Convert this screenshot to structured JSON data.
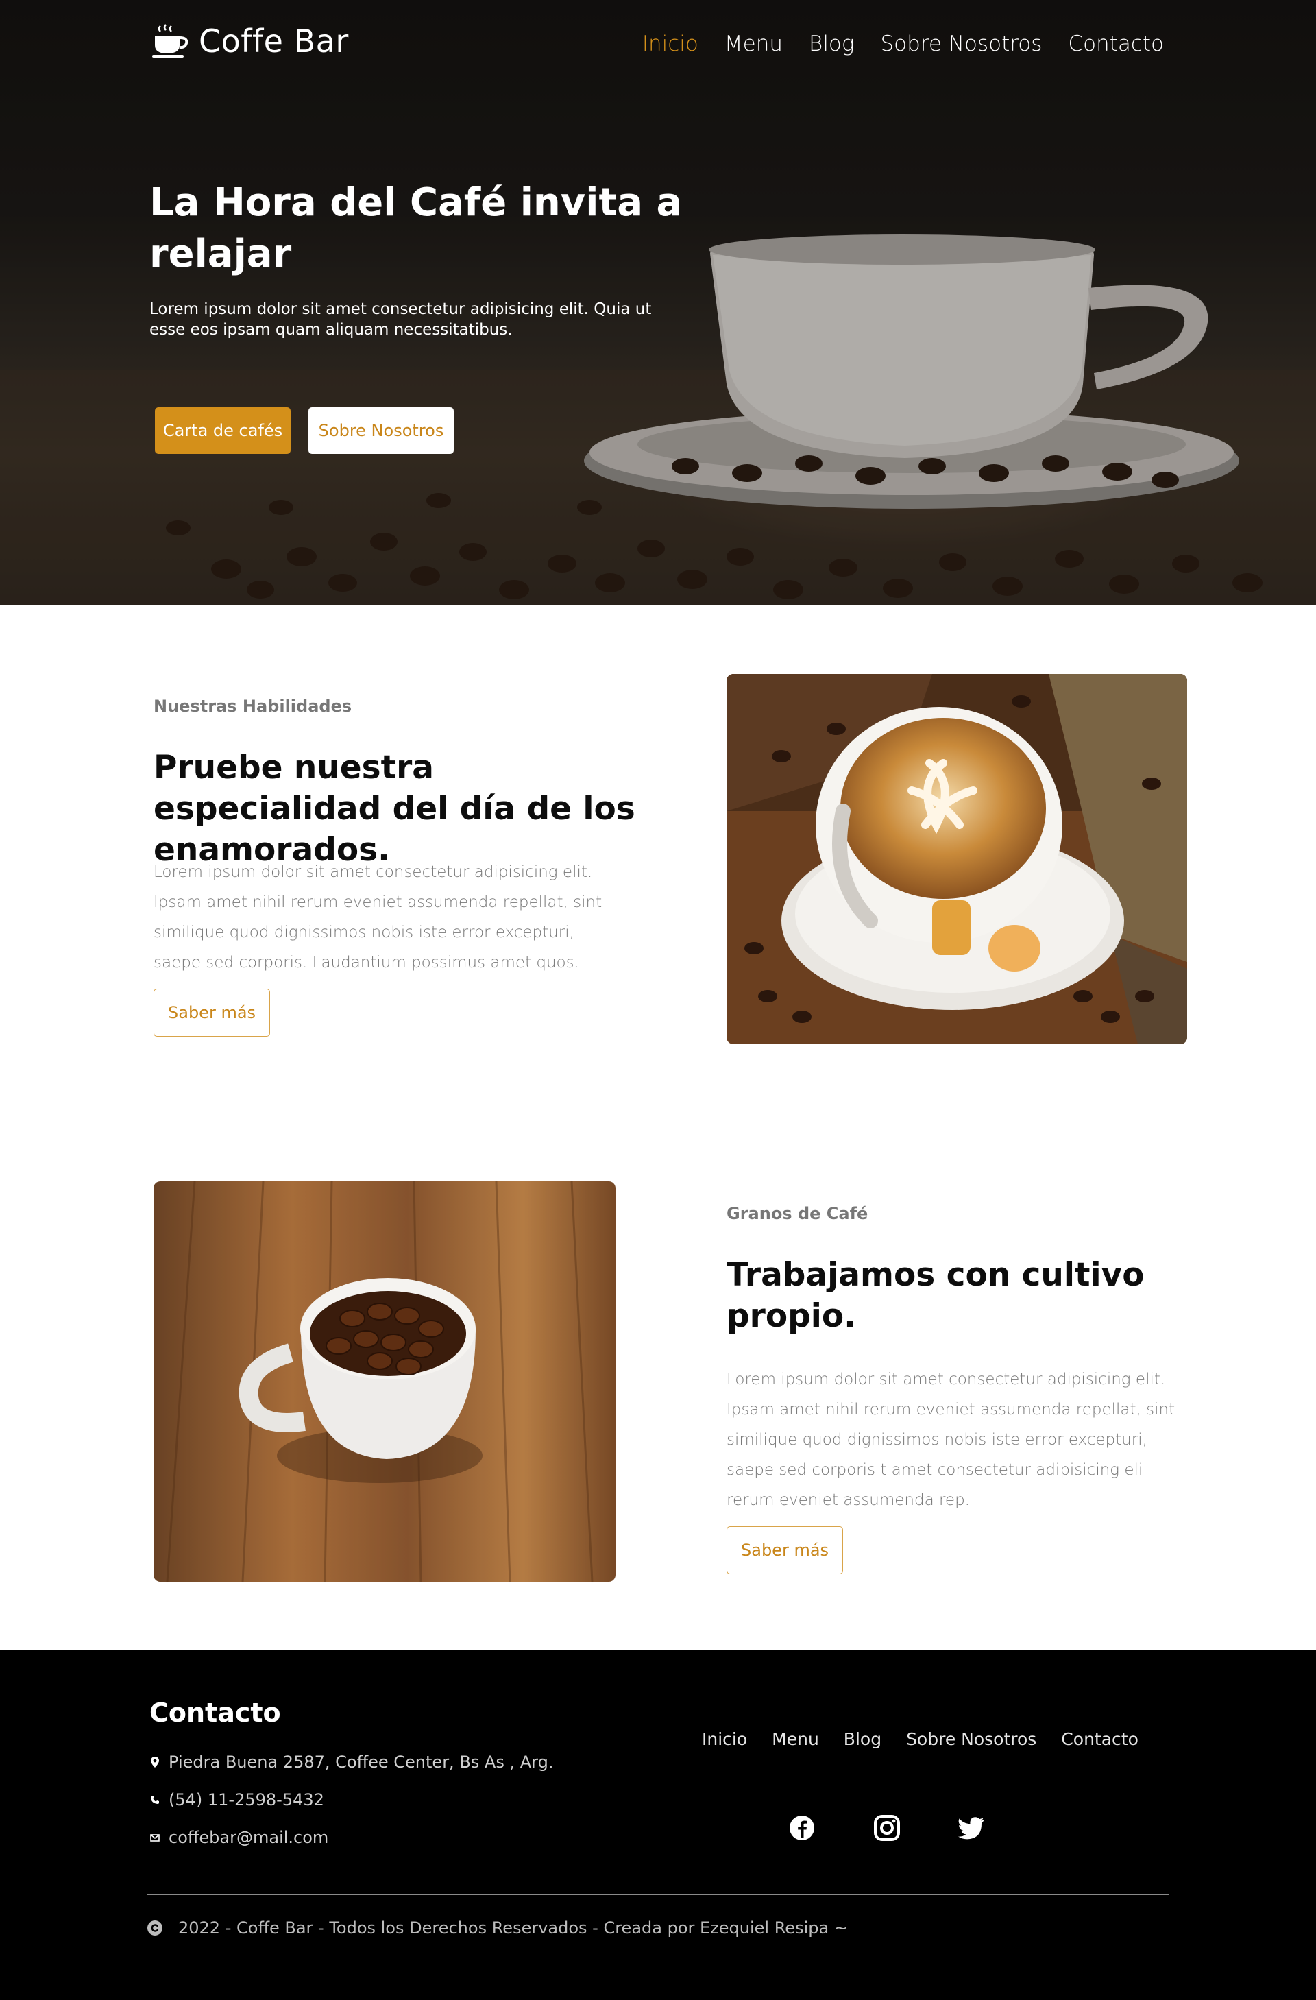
{
  "brand": {
    "name": "Coffe Bar",
    "icon": "coffee-cup-icon"
  },
  "nav": {
    "items": [
      {
        "label": "Inicio",
        "active": true
      },
      {
        "label": "Menu",
        "active": false
      },
      {
        "label": "Blog",
        "active": false
      },
      {
        "label": "Sobre Nosotros",
        "active": false
      },
      {
        "label": "Contacto",
        "active": false
      }
    ]
  },
  "hero": {
    "title": "La Hora del Café invita a relajar",
    "subtitle": "Lorem ipsum dolor sit amet consectetur adipisicing elit. Quia ut esse eos ipsam quam aliquam necessitatibus.",
    "primary_button": "Carta de cafés",
    "secondary_button": "Sobre Nosotros"
  },
  "sections": [
    {
      "eyebrow": "Nuestras Habilidades",
      "title": "Pruebe nuestra especialidad del día de los enamorados.",
      "body": "Lorem ipsum dolor sit amet consectetur adipisicing elit. Ipsam amet nihil rerum eveniet assumenda repellat, sint similique quod dignissimos nobis iste error excepturi, saepe sed corporis. Laudantium possimus amet quos.",
      "button": "Saber más"
    },
    {
      "eyebrow": "Granos de Café",
      "title": "Trabajamos con cultivo propio.",
      "body": "Lorem ipsum dolor sit amet consectetur adipisicing elit. Ipsam amet nihil rerum eveniet assumenda repellat, sint similique quod dignissimos nobis iste error excepturi, saepe sed corporis t amet consectetur adipisicing eli rerum eveniet assumenda rep.",
      "button": "Saber más"
    }
  ],
  "footer": {
    "title": "Contacto",
    "address": "Piedra Buena 2587, Coffee Center, Bs As , Arg.",
    "phone": "(54) 11-2598-5432",
    "email": "coffebar@mail.com",
    "links": [
      "Inicio",
      "Menu",
      "Blog",
      "Sobre Nosotros",
      "Contacto"
    ],
    "socials": [
      "facebook-icon",
      "instagram-icon",
      "twitter-icon"
    ],
    "copyright": "2022 - Coffe Bar - Todos los Derechos Reservados - Creada por Ezequiel Resipa ~"
  },
  "colors": {
    "accent": "#d4901a",
    "footer_bg": "#000000",
    "text_muted": "#7a7a7a"
  }
}
